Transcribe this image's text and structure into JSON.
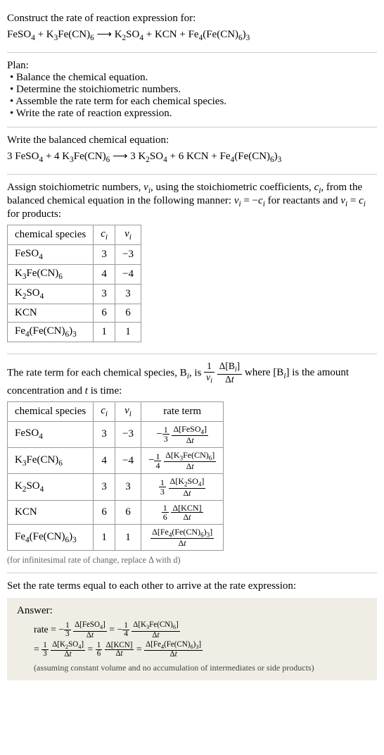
{
  "header": {
    "prompt": "Construct the rate of reaction expression for:",
    "equation_html": "FeSO<sub>4</sub> + K<sub>3</sub>Fe(CN)<sub>6</sub> <span class='arrow'>⟶</span> K<sub>2</sub>SO<sub>4</sub> + KCN + Fe<sub>4</sub>(Fe(CN)<sub>6</sub>)<sub>3</sub>"
  },
  "plan": {
    "title": "Plan:",
    "items": [
      "Balance the chemical equation.",
      "Determine the stoichiometric numbers.",
      "Assemble the rate term for each chemical species.",
      "Write the rate of reaction expression."
    ]
  },
  "balanced": {
    "title": "Write the balanced chemical equation:",
    "equation_html": "3 FeSO<sub>4</sub> + 4 K<sub>3</sub>Fe(CN)<sub>6</sub> <span class='arrow'>⟶</span> 3 K<sub>2</sub>SO<sub>4</sub> + 6 KCN + Fe<sub>4</sub>(Fe(CN)<sub>6</sub>)<sub>3</sub>"
  },
  "stoich": {
    "intro_html": "Assign stoichiometric numbers, <i>ν<sub>i</sub></i>, using the stoichiometric coefficients, <i>c<sub>i</sub></i>, from the balanced chemical equation in the following manner: <i>ν<sub>i</sub></i> = −<i>c<sub>i</sub></i> for reactants and <i>ν<sub>i</sub></i> = <i>c<sub>i</sub></i> for products:",
    "headers": [
      "chemical species",
      "c_i",
      "ν_i"
    ],
    "rows": [
      {
        "species_html": "FeSO<sub>4</sub>",
        "c": "3",
        "nu": "−3"
      },
      {
        "species_html": "K<sub>3</sub>Fe(CN)<sub>6</sub>",
        "c": "4",
        "nu": "−4"
      },
      {
        "species_html": "K<sub>2</sub>SO<sub>4</sub>",
        "c": "3",
        "nu": "3"
      },
      {
        "species_html": "KCN",
        "c": "6",
        "nu": "6"
      },
      {
        "species_html": "Fe<sub>4</sub>(Fe(CN)<sub>6</sub>)<sub>3</sub>",
        "c": "1",
        "nu": "1"
      }
    ]
  },
  "rateterm": {
    "intro_pre": "The rate term for each chemical species, B",
    "intro_mid": ", is ",
    "intro_post_html": " where [B<sub><i>i</i></sub>] is the amount concentration and <i>t</i> is time:",
    "headers": [
      "chemical species",
      "c_i",
      "ν_i",
      "rate term"
    ],
    "rows": [
      {
        "species_html": "FeSO<sub>4</sub>",
        "c": "3",
        "nu": "−3",
        "rate_neg": true,
        "rate_coef_num": "1",
        "rate_coef_den": "3",
        "conc_html": "Δ[FeSO<sub>4</sub>]"
      },
      {
        "species_html": "K<sub>3</sub>Fe(CN)<sub>6</sub>",
        "c": "4",
        "nu": "−4",
        "rate_neg": true,
        "rate_coef_num": "1",
        "rate_coef_den": "4",
        "conc_html": "Δ[K<sub>3</sub>Fe(CN)<sub>6</sub>]"
      },
      {
        "species_html": "K<sub>2</sub>SO<sub>4</sub>",
        "c": "3",
        "nu": "3",
        "rate_neg": false,
        "rate_coef_num": "1",
        "rate_coef_den": "3",
        "conc_html": "Δ[K<sub>2</sub>SO<sub>4</sub>]"
      },
      {
        "species_html": "KCN",
        "c": "6",
        "nu": "6",
        "rate_neg": false,
        "rate_coef_num": "1",
        "rate_coef_den": "6",
        "conc_html": "Δ[KCN]"
      },
      {
        "species_html": "Fe<sub>4</sub>(Fe(CN)<sub>6</sub>)<sub>3</sub>",
        "c": "1",
        "nu": "1",
        "rate_neg": false,
        "rate_coef_num": "",
        "rate_coef_den": "",
        "conc_html": "Δ[Fe<sub>4</sub>(Fe(CN)<sub>6</sub>)<sub>3</sub>]"
      }
    ],
    "note": "(for infinitesimal rate of change, replace Δ with d)"
  },
  "final": {
    "title": "Set the rate terms equal to each other to arrive at the rate expression:",
    "answer_label": "Answer:",
    "rate_prefix": "rate = ",
    "terms": [
      {
        "neg": true,
        "num": "1",
        "den": "3",
        "conc_html": "Δ[FeSO<sub>4</sub>]"
      },
      {
        "neg": true,
        "num": "1",
        "den": "4",
        "conc_html": "Δ[K<sub>3</sub>Fe(CN)<sub>6</sub>]"
      },
      {
        "neg": false,
        "num": "1",
        "den": "3",
        "conc_html": "Δ[K<sub>2</sub>SO<sub>4</sub>]"
      },
      {
        "neg": false,
        "num": "1",
        "den": "6",
        "conc_html": "Δ[KCN]"
      },
      {
        "neg": false,
        "num": "",
        "den": "",
        "conc_html": "Δ[Fe<sub>4</sub>(Fe(CN)<sub>6</sub>)<sub>3</sub>]"
      }
    ],
    "assume": "(assuming constant volume and no accumulation of intermediates or side products)"
  },
  "dt": "Δ<i>t</i>"
}
